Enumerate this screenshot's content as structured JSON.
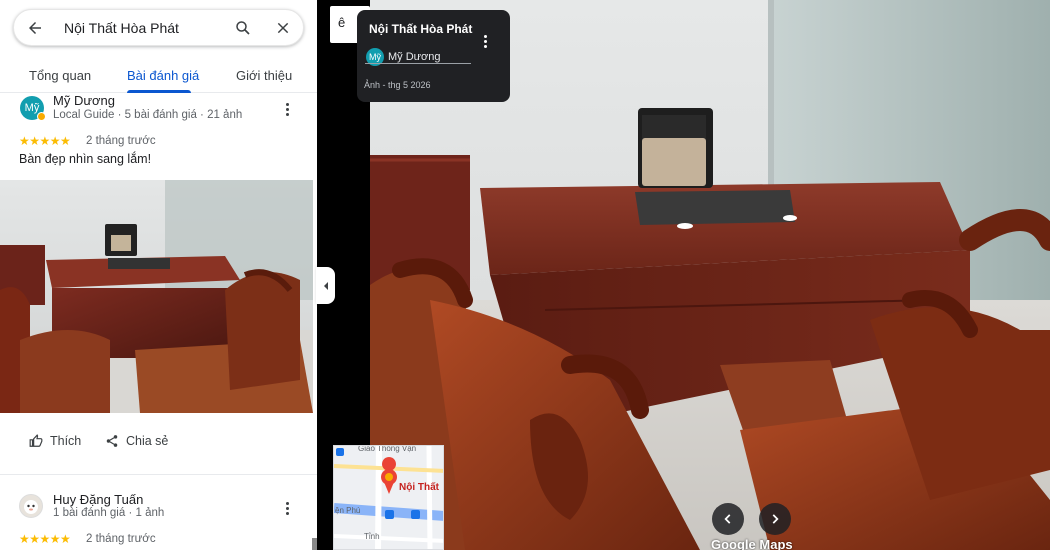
{
  "search": {
    "query": "Nội Thất Hòa Phát"
  },
  "tabs": [
    {
      "label": "Tổng quan"
    },
    {
      "label": "Bài đánh giá"
    },
    {
      "label": "Giới thiệu"
    }
  ],
  "active_tab": "Bài đánh giá",
  "reviews": [
    {
      "avatar": "Mỹ",
      "name": "Mỹ Dương",
      "meta": "Local Guide · 5 bài đánh giá · 21 ảnh",
      "stars": "★★★★★",
      "rating": 5,
      "time": "2 tháng trước",
      "text": "Bàn đẹp nhìn sang lắm!"
    },
    {
      "name": "Huy Đặng Tuấn",
      "meta": "1 bài đánh giá · 1 ảnh",
      "stars": "★★★★★",
      "rating": 5,
      "time": "2 tháng trước"
    }
  ],
  "actions": {
    "like": "Thích",
    "share": "Chia sẻ"
  },
  "viewer": {
    "title": "Nội Thất Hòa Phát",
    "user_avatar": "Mỹ",
    "user": "Mỹ Dương",
    "date": "Ảnh - thg 5 2026",
    "lang_button": "ê",
    "map_place": "Nội Thất",
    "map_roads": [
      "Giao Thông Vận",
      "ện Phú",
      "Tỉnh"
    ],
    "watermark": "Google Maps"
  },
  "colors": {
    "accent": "#0b57d0",
    "star": "#fbbc04",
    "avatar_my": "#129eaf",
    "map_pin": "#ea4335"
  },
  "icons": [
    "back-arrow-icon",
    "search-icon",
    "close-icon",
    "more-vert-icon",
    "thumb-up-icon",
    "share-icon",
    "chevron-left-icon",
    "chevron-right-icon",
    "caret-down-icon",
    "map-pin-icon",
    "bus-stop-icon"
  ]
}
